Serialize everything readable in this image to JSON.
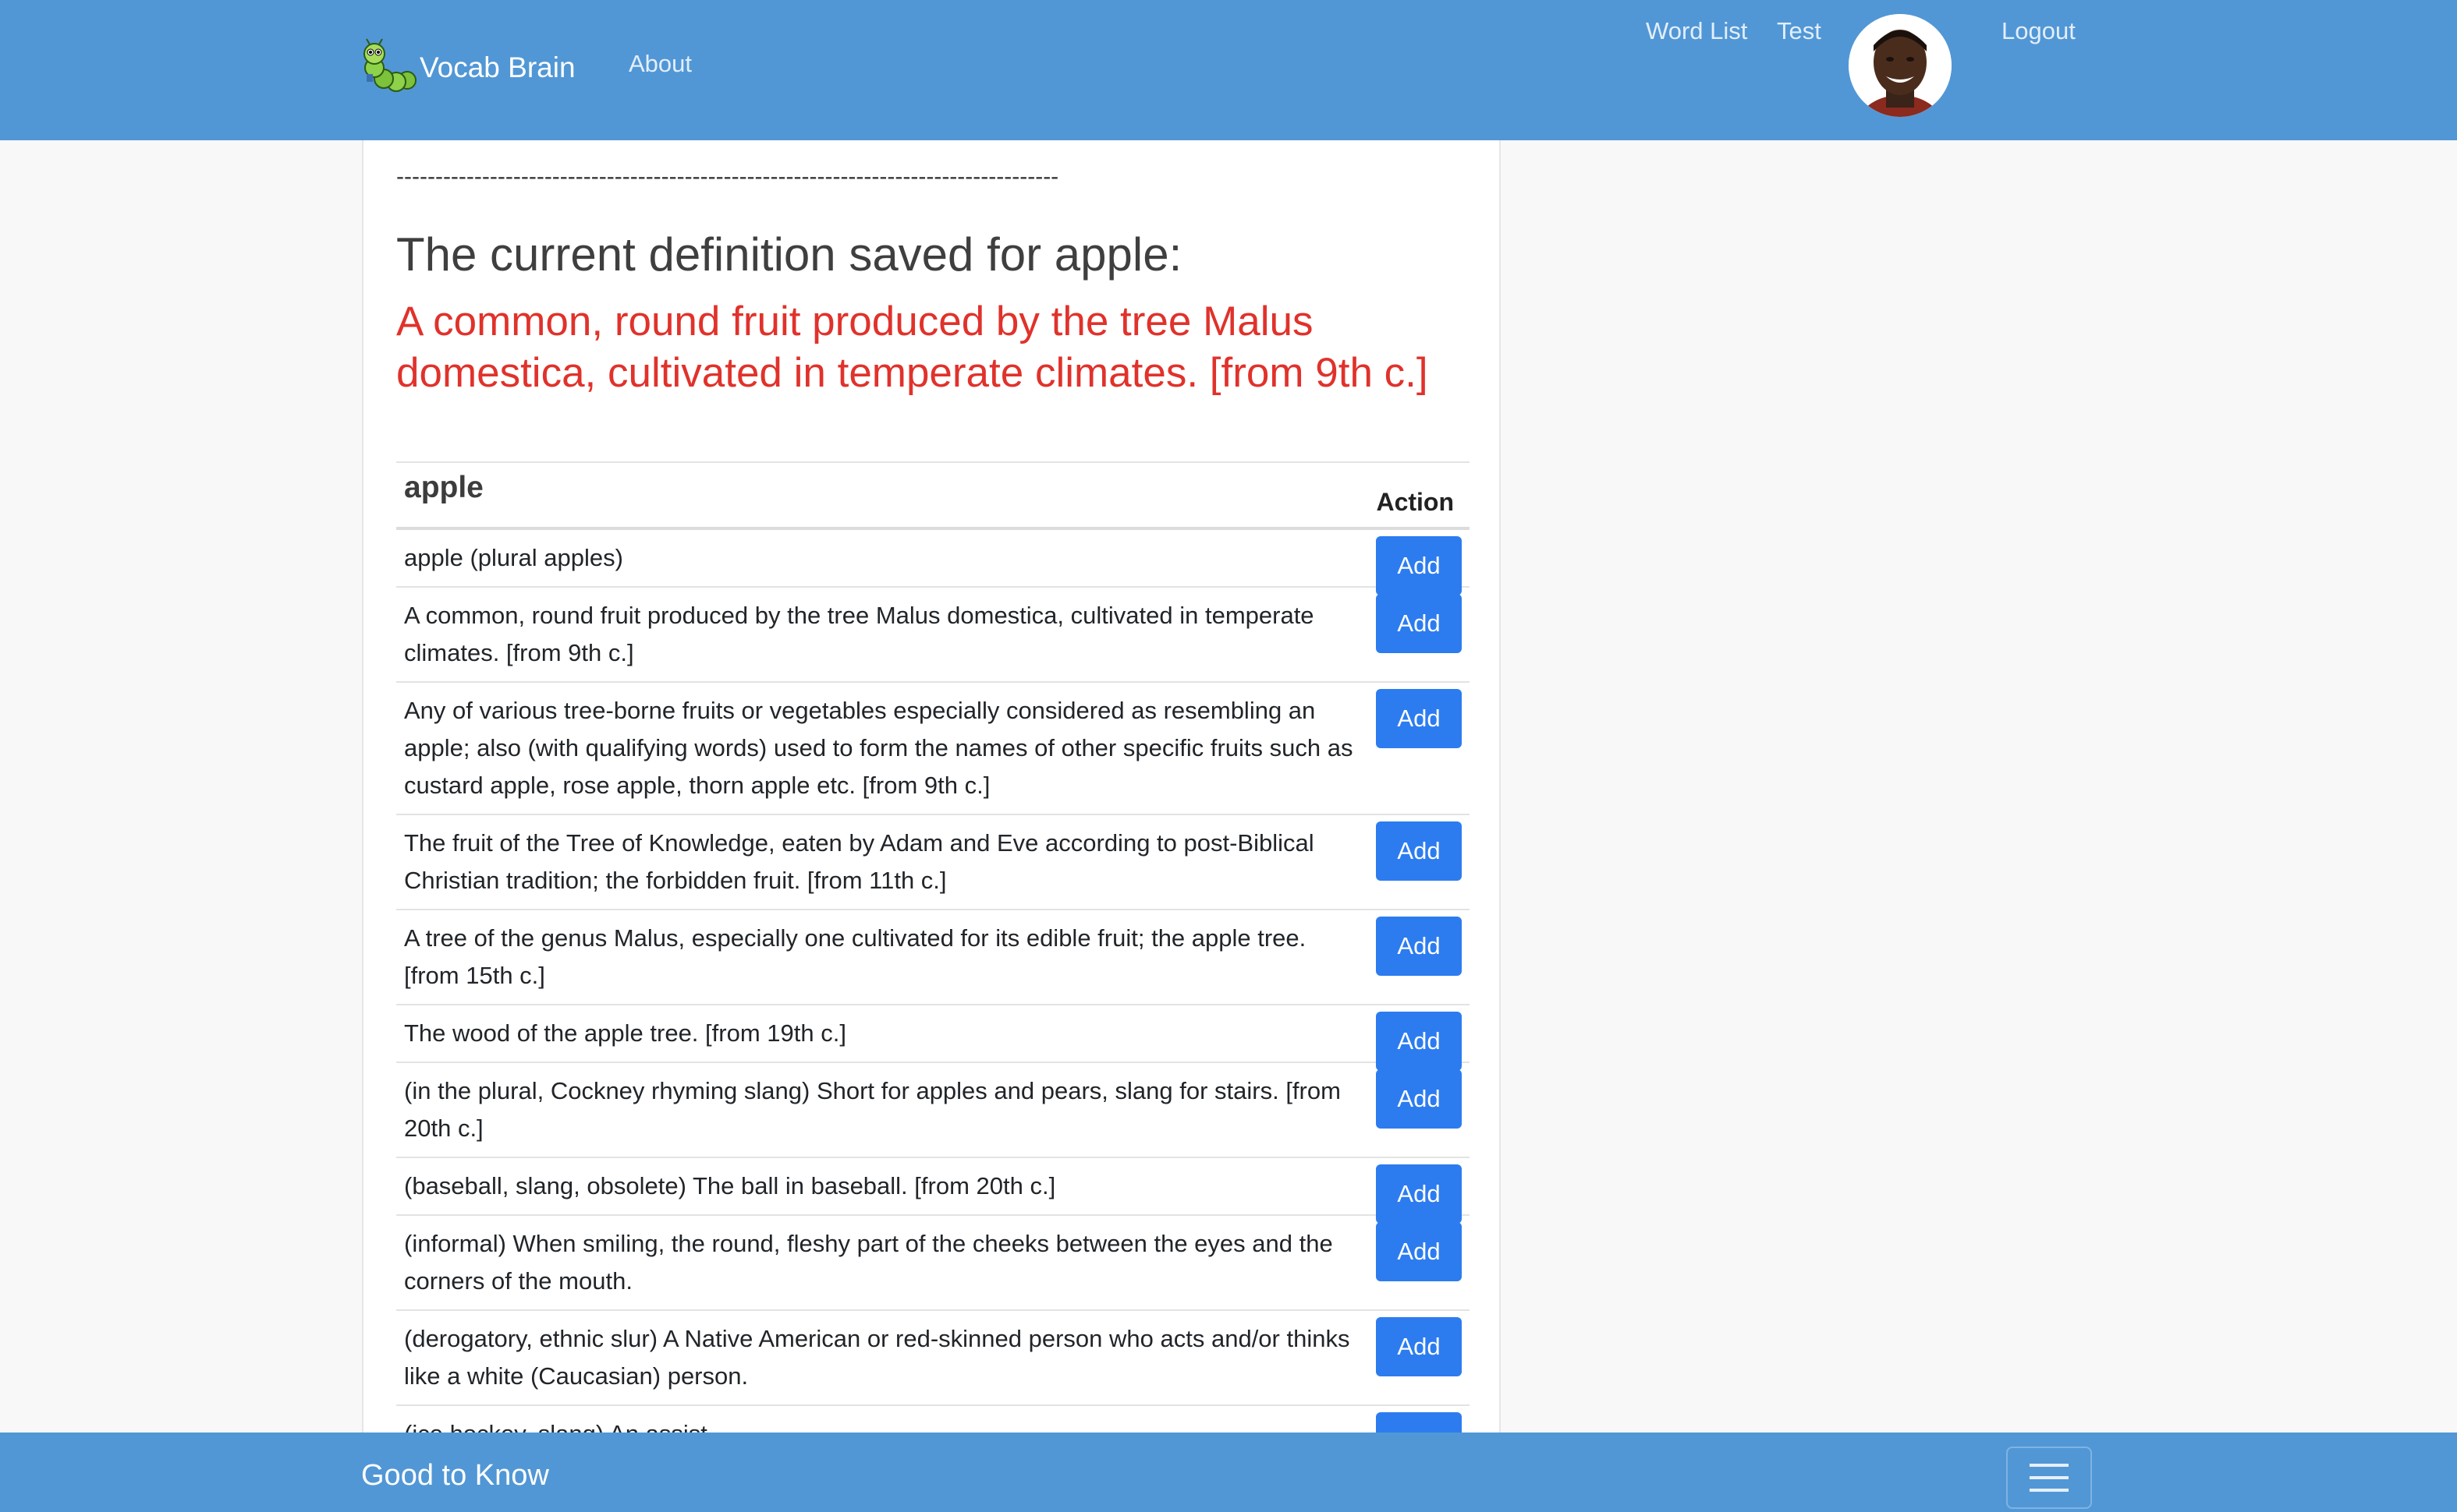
{
  "navbar": {
    "brand": "Vocab Brain",
    "about": "About",
    "word_list": "Word List",
    "test": "Test",
    "logout": "Logout"
  },
  "main": {
    "separator": "-------------------------------------------------------------------------------------",
    "heading": "The current definition saved for apple:",
    "current_definition": "A common, round fruit produced by the tree Malus domestica, cultivated in temperate climates. [from 9th c.]"
  },
  "table": {
    "word": "apple",
    "action_header": "Action",
    "add_label": "Add",
    "rows": [
      "apple (plural apples)",
      "A common, round fruit produced by the tree Malus domestica, cultivated in temperate climates. [from 9th c.]",
      "Any of various tree-borne fruits or vegetables especially considered as resembling an apple; also (with qualifying words) used to form the names of other specific fruits such as custard apple, rose apple, thorn apple etc. [from 9th c.]",
      "The fruit of the Tree of Knowledge, eaten by Adam and Eve according to post-Biblical Christian tradition; the forbidden fruit. [from 11th c.]",
      "A tree of the genus Malus, especially one cultivated for its edible fruit; the apple tree. [from 15th c.]",
      "The wood of the apple tree. [from 19th c.]",
      "(in the plural, Cockney rhyming slang) Short for apples and pears, slang for stairs. [from 20th c.]",
      "(baseball, slang, obsolete) The ball in baseball. [from 20th c.]",
      "(informal) When smiling, the round, fleshy part of the cheeks between the eyes and the corners of the mouth.",
      "(derogatory, ethnic slur) A Native American or red-skinned person who acts and/or thinks like a white (Caucasian) person.",
      "(ice hockey, slang) An assist."
    ]
  },
  "footer": {
    "title": "Good to Know"
  },
  "icons": {
    "logo": "caterpillar-logo-icon",
    "avatar": "user-avatar",
    "menu": "hamburger-menu-icon"
  },
  "colors": {
    "navbar": "#5197d6",
    "accent_red": "#e0322b",
    "button": "#2c7cf0"
  }
}
